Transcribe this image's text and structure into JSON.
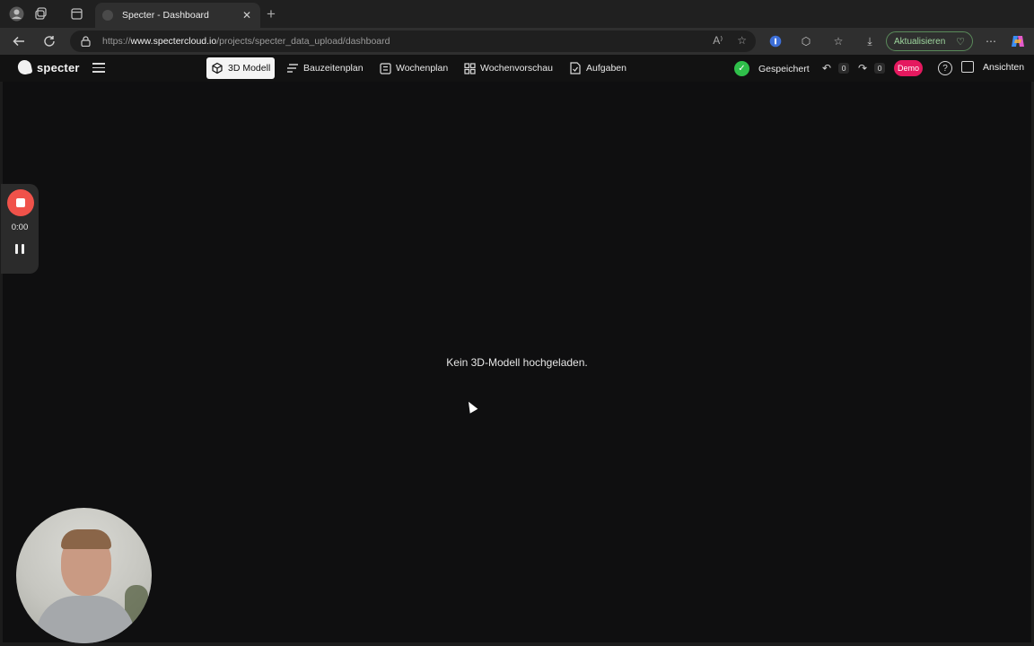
{
  "browser": {
    "tab_title": "Specter - Dashboard",
    "url_prefix": "https://",
    "url_domain": "www.spectercloud.io",
    "url_path": "/projects/specter_data_upload/dashboard",
    "update_label": "Aktualisieren"
  },
  "app": {
    "logo_text": "specter",
    "nav": [
      {
        "label": "3D Modell",
        "icon": "cube-icon",
        "active": true
      },
      {
        "label": "Bauzeitenplan",
        "icon": "gantt-icon",
        "active": false
      },
      {
        "label": "Wochenplan",
        "icon": "list-icon",
        "active": false
      },
      {
        "label": "Wochenvorschau",
        "icon": "grid-icon",
        "active": false
      },
      {
        "label": "Aufgaben",
        "icon": "task-icon",
        "active": false
      }
    ],
    "saved_label": "Gespeichert",
    "undo_count": "0",
    "redo_count": "0",
    "demo_label": "Demo",
    "views_label": "Ansichten"
  },
  "main": {
    "empty_message": "Kein 3D-Modell hochgeladen."
  },
  "recorder": {
    "time": "0:00"
  },
  "colors": {
    "accent_saved": "#2fbf4a",
    "demo_badge": "#e5195f",
    "recorder_stop": "#f0524a"
  }
}
